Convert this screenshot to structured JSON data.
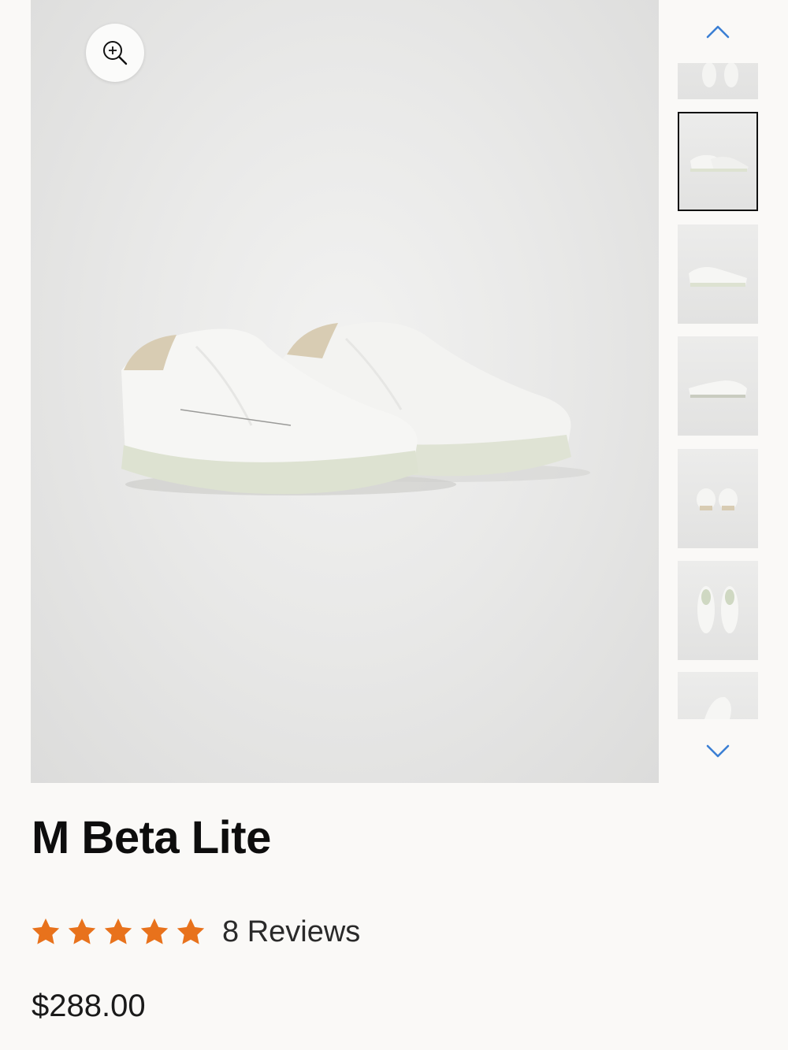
{
  "product": {
    "title": "M Beta Lite",
    "rating": 5,
    "rating_max": 5,
    "reviews_label": "8 Reviews",
    "price": "$288.00"
  },
  "gallery": {
    "selected_index": 1,
    "thumbnail_count": 7
  },
  "colors": {
    "star": "#e8721c",
    "arrow": "#3b7fd4",
    "selected_border": "#111111"
  },
  "icons": {
    "zoom": "zoom-in-icon",
    "up": "chevron-up-icon",
    "down": "chevron-down-icon",
    "star": "star-icon"
  }
}
